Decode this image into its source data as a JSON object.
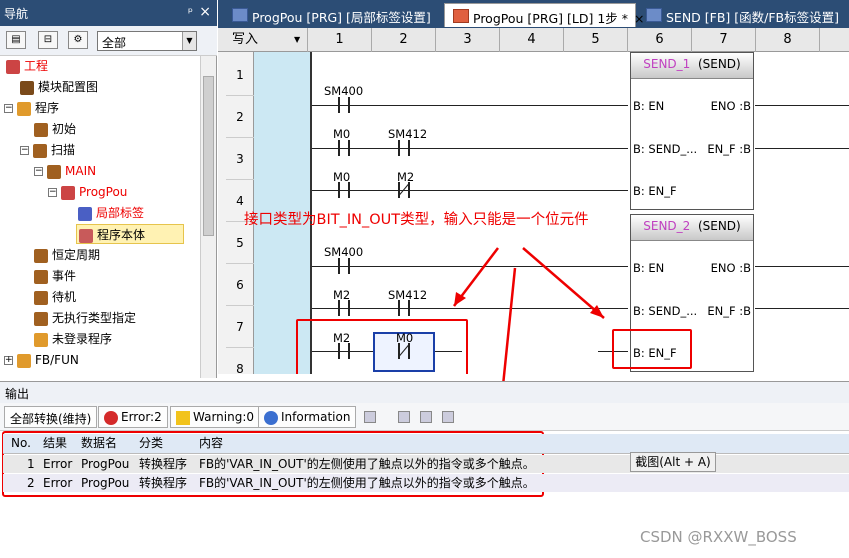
{
  "nav": {
    "title": "导航",
    "pin": "ᵖ",
    "close": "×",
    "dropdown_value": "全部",
    "tree": [
      {
        "label": "工程",
        "red": true
      },
      {
        "label": "模块配置图"
      },
      {
        "label": "程序"
      },
      {
        "label": "初始"
      },
      {
        "label": "扫描"
      },
      {
        "label": "MAIN",
        "red": true
      },
      {
        "label": "ProgPou",
        "red": true
      },
      {
        "label": "局部标签",
        "red": true
      },
      {
        "label": "程序本体",
        "selected": true
      },
      {
        "label": "恒定周期"
      },
      {
        "label": "事件"
      },
      {
        "label": "待机"
      },
      {
        "label": "无执行类型指定"
      },
      {
        "label": "未登录程序"
      },
      {
        "label": "FB/FUN"
      }
    ]
  },
  "tabs": [
    {
      "label": "ProgPou [PRG] [局部标签设置]"
    },
    {
      "label": "ProgPou [PRG] [LD] 1步 *",
      "active": true
    },
    {
      "label": "SEND [FB] [函数/FB标签设置]"
    }
  ],
  "ladder": {
    "mode": "写入",
    "columns": [
      "1",
      "2",
      "3",
      "4",
      "5",
      "6",
      "7",
      "8"
    ],
    "rows": [
      "1",
      "2",
      "3",
      "4",
      "5",
      "6",
      "7",
      "8"
    ],
    "contacts": [
      {
        "label": "SM400"
      },
      {
        "label": "M0"
      },
      {
        "label": "SM412"
      },
      {
        "label": "M0"
      },
      {
        "label": "M2"
      },
      {
        "label": "SM400"
      },
      {
        "label": "M2"
      },
      {
        "label": "SM412"
      },
      {
        "label": "M2"
      },
      {
        "label": "M0"
      }
    ],
    "fb1": {
      "name": "SEND_1",
      "type": "(SEND)",
      "pins": [
        "B: EN",
        "ENO :B",
        "B: SEND_...",
        "EN_F :B",
        "B: EN_F"
      ]
    },
    "fb2": {
      "name": "SEND_2",
      "type": "(SEND)",
      "pins": [
        "B: EN",
        "ENO :B",
        "B: SEND_...",
        "EN_F :B",
        "B: EN_F"
      ]
    },
    "annotation": "接口类型为BIT_IN_OUT类型，输入只能是一个位元件"
  },
  "output": {
    "title": "输出",
    "buttons": {
      "convert_all": "全部转换(维持)",
      "error": "Error:2",
      "warning": "Warning:0",
      "information": "Information"
    },
    "headers": [
      "No.",
      "结果",
      "数据名",
      "分类",
      "内容"
    ],
    "rows": [
      {
        "no": "1",
        "result": "Error",
        "data": "ProgPou",
        "category": "转换程序",
        "content": "FB的'VAR_IN_OUT'的左侧使用了触点以外的指令或多个触点。"
      },
      {
        "no": "2",
        "result": "Error",
        "data": "ProgPou",
        "category": "转换程序",
        "content": "FB的'VAR_IN_OUT'的左侧使用了触点以外的指令或多个触点。"
      }
    ],
    "tooltip": "截图(Alt + A)"
  },
  "watermark": "CSDN @RXXW_BOSS"
}
